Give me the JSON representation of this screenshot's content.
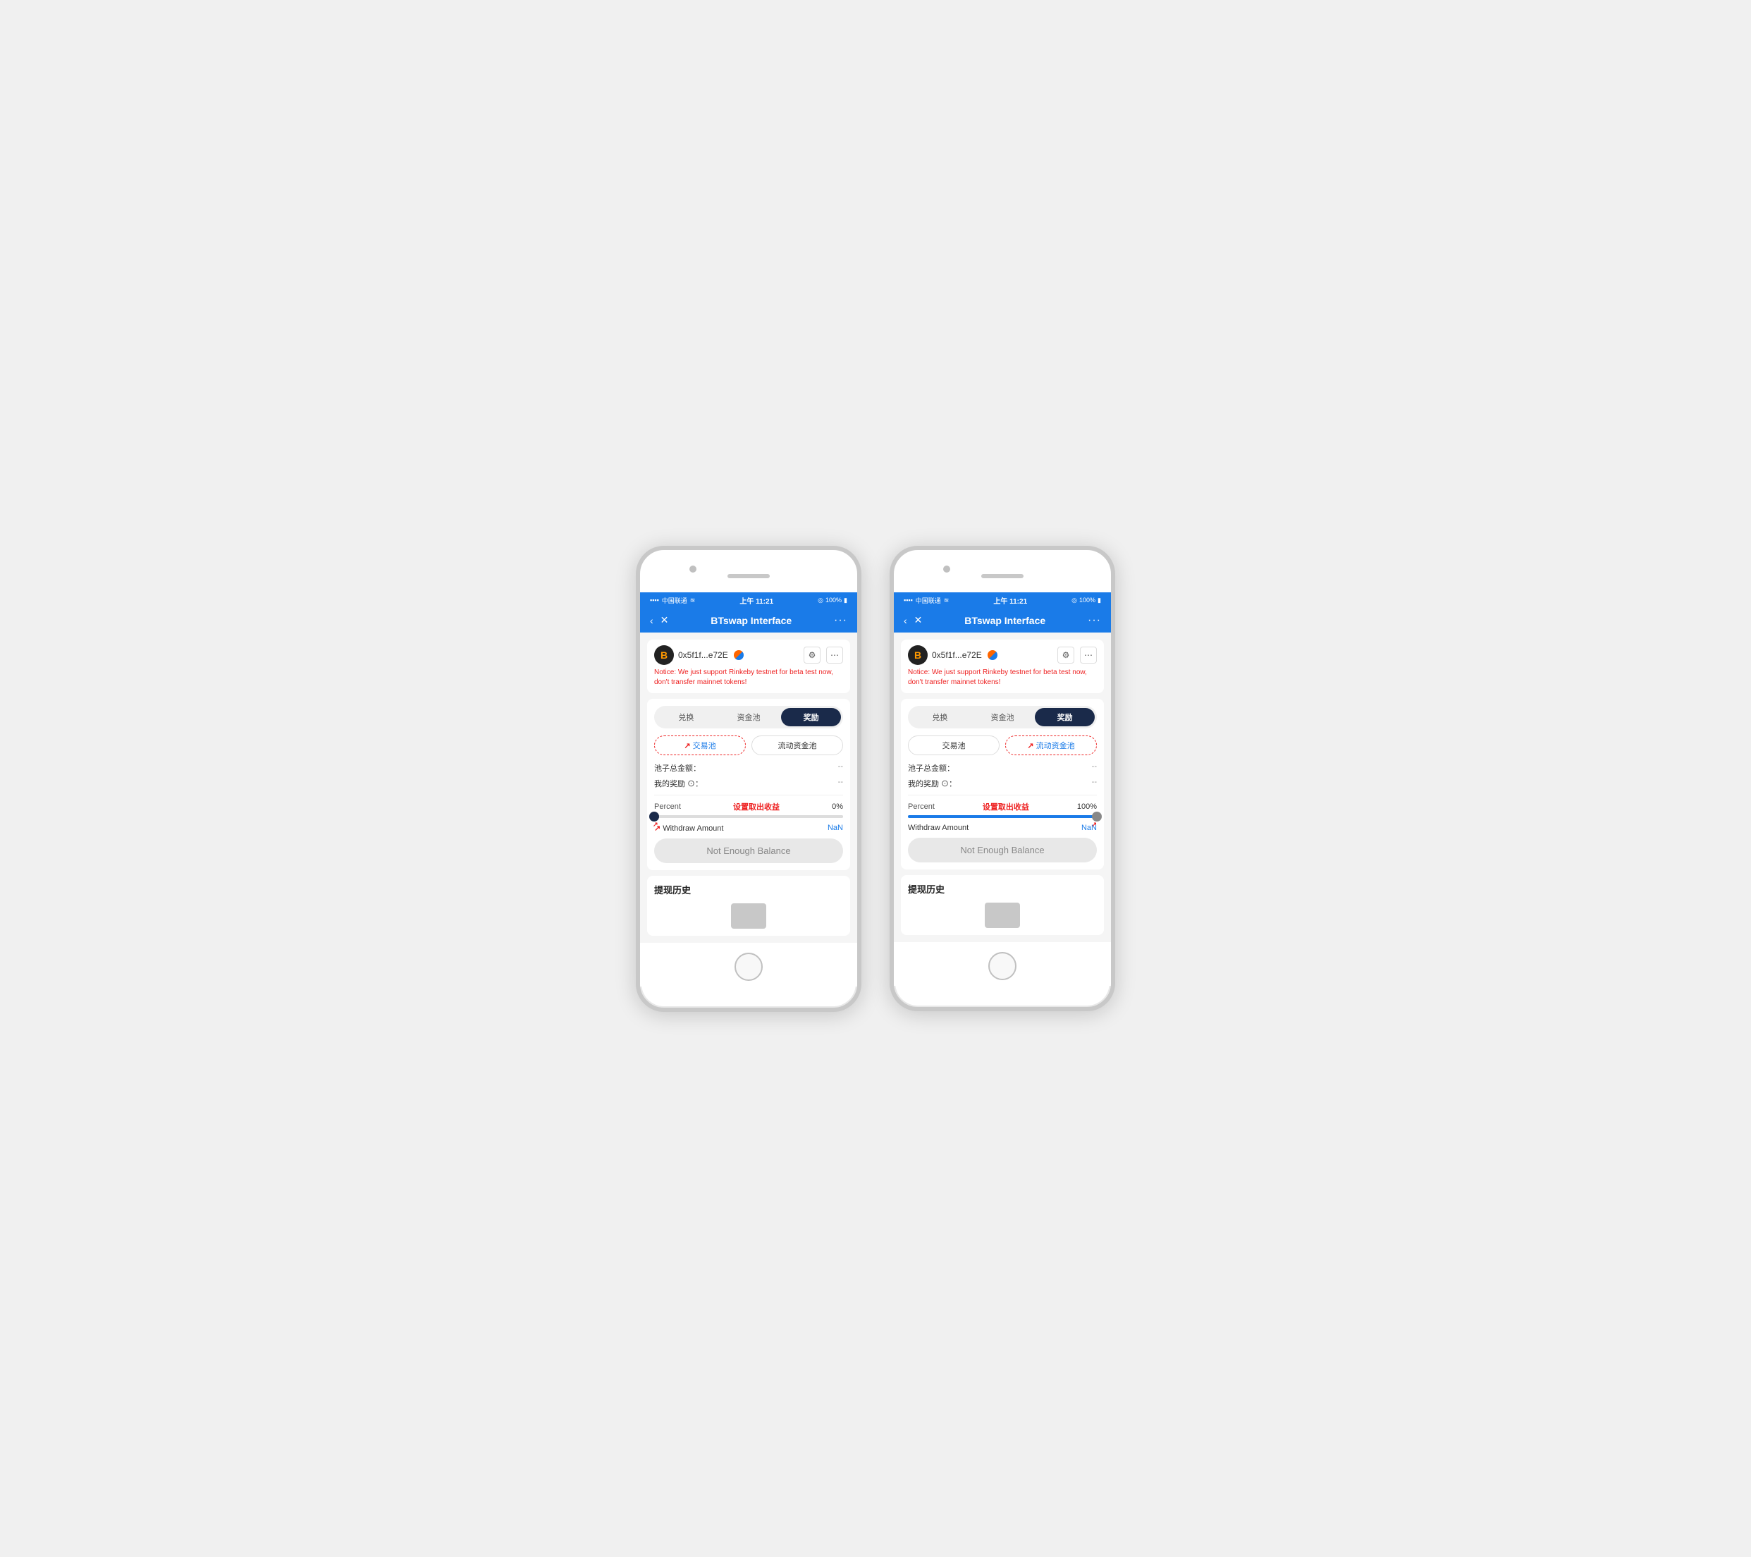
{
  "phones": [
    {
      "id": "phone-left",
      "status_bar": {
        "carrier": "中国联通",
        "time": "上午 11:21",
        "battery": "100%"
      },
      "nav": {
        "title": "BTswap Interface",
        "back_label": "‹",
        "close_label": "✕",
        "more_label": "···"
      },
      "account": {
        "address": "0x5f1f...e72E",
        "icon_label": "B"
      },
      "notice": "Notice: We just support Rinkeby testnet for beta test now, don't transfer mainnet tokens!",
      "tabs": [
        {
          "label": "兑换",
          "active": false
        },
        {
          "label": "资金池",
          "active": false
        },
        {
          "label": "奖励",
          "active": true
        }
      ],
      "sub_tabs": [
        {
          "label": "交易池",
          "selected": true,
          "dashed": true
        },
        {
          "label": "流动资金池",
          "selected": false,
          "dashed": false
        }
      ],
      "pool_total_label": "池子总金额：",
      "pool_total_value": "--",
      "my_reward_label": "我的奖励 ⊙：",
      "my_reward_value": "--",
      "slider": {
        "label": "Percent",
        "annotation": "设置取出收益",
        "percent": "0%",
        "fill_percent": 0,
        "thumb_position": "left"
      },
      "withdraw_label": "Withdraw Amount",
      "withdraw_value": "NaN",
      "balance_btn": "Not Enough Balance",
      "history_title": "提现历史"
    },
    {
      "id": "phone-right",
      "status_bar": {
        "carrier": "中国联通",
        "time": "上午 11:21",
        "battery": "100%"
      },
      "nav": {
        "title": "BTswap Interface",
        "back_label": "‹",
        "close_label": "✕",
        "more_label": "···"
      },
      "account": {
        "address": "0x5f1f...e72E",
        "icon_label": "B"
      },
      "notice": "Notice: We just support Rinkeby testnet for beta test now, don't transfer mainnet tokens!",
      "tabs": [
        {
          "label": "兑换",
          "active": false
        },
        {
          "label": "资金池",
          "active": false
        },
        {
          "label": "奖励",
          "active": true
        }
      ],
      "sub_tabs": [
        {
          "label": "交易池",
          "selected": false,
          "dashed": false
        },
        {
          "label": "流动资金池",
          "selected": true,
          "dashed": true
        }
      ],
      "pool_total_label": "池子总金额：",
      "pool_total_value": "--",
      "my_reward_label": "我的奖励 ⊙：",
      "my_reward_value": "--",
      "slider": {
        "label": "Percent",
        "annotation": "设置取出收益",
        "percent": "100%",
        "fill_percent": 100,
        "thumb_position": "right"
      },
      "withdraw_label": "Withdraw Amount",
      "withdraw_value": "NaN",
      "balance_btn": "Not Enough Balance",
      "history_title": "提现历史"
    }
  ]
}
